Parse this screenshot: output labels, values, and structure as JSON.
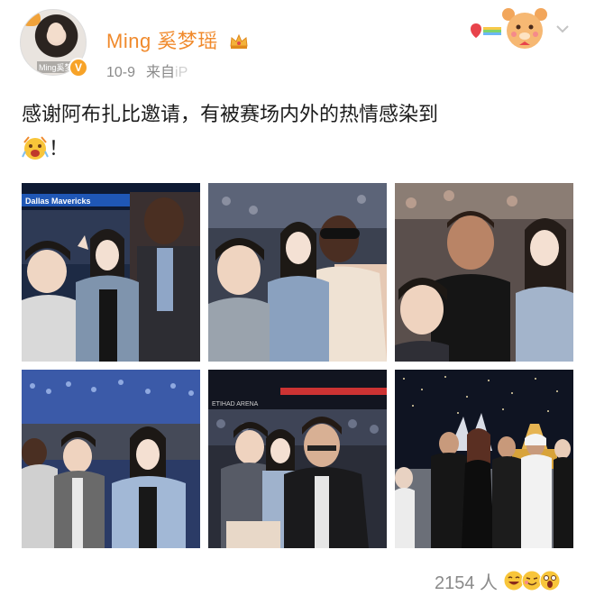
{
  "post": {
    "author": {
      "name": "Ming 奚梦瑶",
      "avatar_caption": "Ming奚梦瑶",
      "verified": true,
      "crown": "crown-icon"
    },
    "meta": {
      "date": "10-9",
      "source_prefix": "来自",
      "source_faded": "iP"
    },
    "text_line1": "感谢阿布扎比邀请，有被赛场内外的热情感染到",
    "text_line2": "！",
    "photos": [
      {
        "label": "photo-1",
        "banner": "Dallas Mavericks"
      },
      {
        "label": "photo-2"
      },
      {
        "label": "photo-3"
      },
      {
        "label": "photo-4"
      },
      {
        "label": "photo-5",
        "banner": "ETIHAD ARENA"
      },
      {
        "label": "photo-6"
      }
    ],
    "reaction_count": "2154 人",
    "reactions": [
      "laugh-emoji",
      "wink-emoji",
      "surprise-emoji"
    ]
  },
  "colors": {
    "username": "#f08a2c",
    "meta": "#8a8a8a",
    "verified": "#f7a328"
  }
}
